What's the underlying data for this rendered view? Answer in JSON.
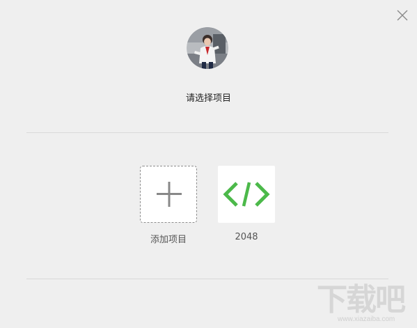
{
  "dialog": {
    "title": "请选择项目",
    "close_icon": "close-icon",
    "avatar_icon": "user-avatar"
  },
  "projects": {
    "add_label": "添加项目",
    "add_icon": "plus-icon",
    "items": [
      {
        "label": "2048",
        "icon": "code-icon",
        "icon_color": "#4cb94a"
      }
    ]
  },
  "watermark": {
    "main": "下载吧",
    "sub": "www.xiazaiba.com"
  },
  "colors": {
    "background": "#efefef",
    "divider": "#d9d9d9",
    "accent_green": "#4cb94a",
    "plus_gray": "#888888"
  }
}
